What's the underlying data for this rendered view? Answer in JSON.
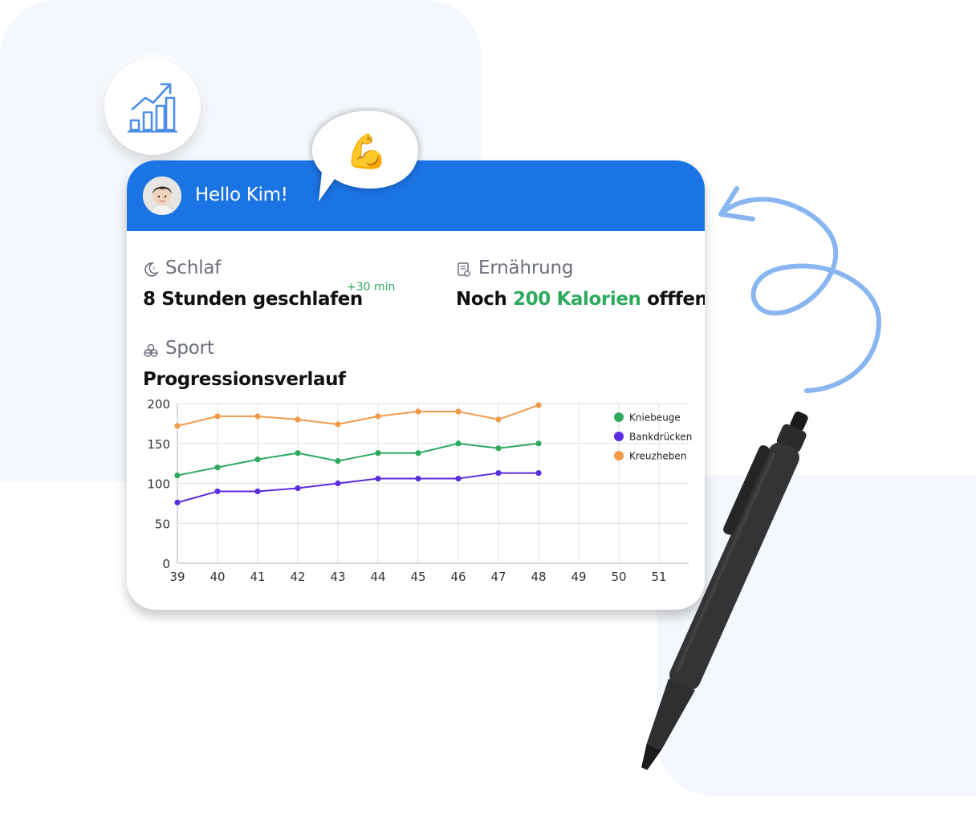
{
  "header": {
    "greeting": "Hello Kim!",
    "bubble_emoji": "💪"
  },
  "sleep": {
    "label": "Schlaf",
    "value": "8 Stunden geschlafen",
    "delta": "+30 min",
    "icon": "moon-icon"
  },
  "nutrition": {
    "label": "Ernährung",
    "prefix": "Noch ",
    "highlight": "200 Kalorien",
    "suffix": " offfen",
    "icon": "clipboard-icon"
  },
  "sport": {
    "label": "Sport",
    "chart_title": "Progressionsverlauf",
    "icon": "dumbbell-icon"
  },
  "colors": {
    "header": "#1b74e4",
    "green": "#2eaa5f",
    "purple": "#5b2ee0",
    "orange": "#f2994a"
  },
  "chart_data": {
    "type": "line",
    "title": "Progressionsverlauf",
    "x": [
      39,
      40,
      41,
      42,
      43,
      44,
      45,
      46,
      47,
      48,
      49,
      50,
      51
    ],
    "xlim": [
      39,
      51
    ],
    "ylim": [
      0,
      200
    ],
    "yticks": [
      0,
      50,
      100,
      150,
      200
    ],
    "grid": true,
    "legend_position": "top-right",
    "series": [
      {
        "name": "Kniebeuge",
        "color": "#2eaa5f",
        "values": [
          110,
          120,
          130,
          138,
          128,
          138,
          138,
          150,
          144,
          150
        ]
      },
      {
        "name": "Bankdrücken",
        "color": "#5b2ee0",
        "values": [
          76,
          90,
          90,
          94,
          100,
          106,
          106,
          106,
          113,
          113
        ]
      },
      {
        "name": "Kreuzheben",
        "color": "#f2994a",
        "values": [
          172,
          184,
          184,
          180,
          174,
          184,
          190,
          190,
          180,
          198
        ]
      }
    ]
  }
}
